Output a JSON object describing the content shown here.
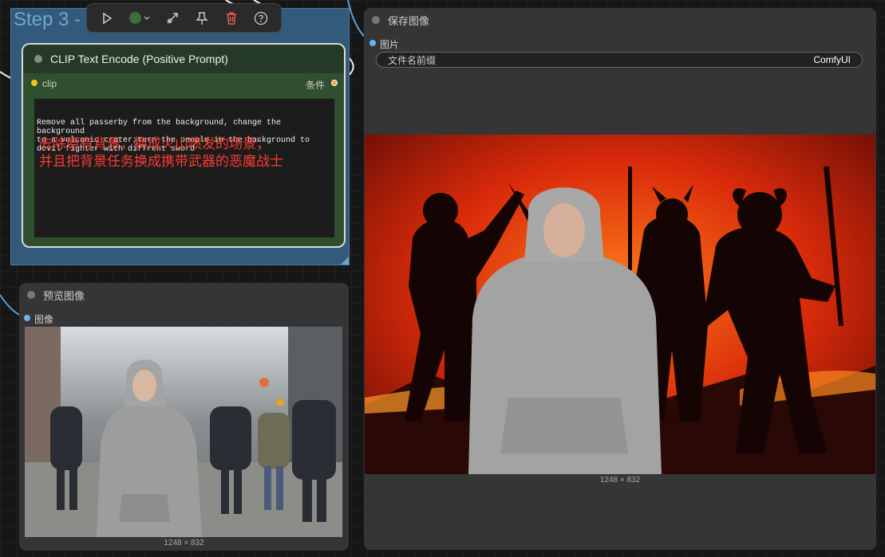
{
  "group": {
    "title": "Step 3 -"
  },
  "clip_node": {
    "title": "CLIP Text Encode (Positive Prompt)",
    "input_label": "clip",
    "output_label": "条件",
    "prompt_text": "Remove all passerby from the background, change the background\nto a volcanic crater;turn the people in the background to\ndevil fighter with diffrent sword",
    "annotation_line1": "去除原有背景，换成火山喷发的场景；",
    "annotation_line2": "并且把背景任务换成携带武器的恶魔战士"
  },
  "toolbar": {
    "icons": [
      "play-icon",
      "color-dot-icon",
      "chevron-down-icon",
      "bypass-icon",
      "pin-icon",
      "trash-icon",
      "help-icon"
    ]
  },
  "preview_node": {
    "title": "预览图像",
    "input_label": "图像",
    "image_caption": "1248 × 832"
  },
  "save_node": {
    "title": "保存图像",
    "input_label": "图片",
    "prefix_label": "文件名前缀",
    "prefix_value": "ComfyUI",
    "image_caption": "1248 × 832"
  },
  "colors": {
    "group_bg": "#335a7a",
    "clip_bg": "#2f4f2f",
    "annotation": "#ff3b2f",
    "slot_clip": "#f5c518",
    "slot_condition": "#ffa040",
    "slot_image": "#64b5f6"
  }
}
